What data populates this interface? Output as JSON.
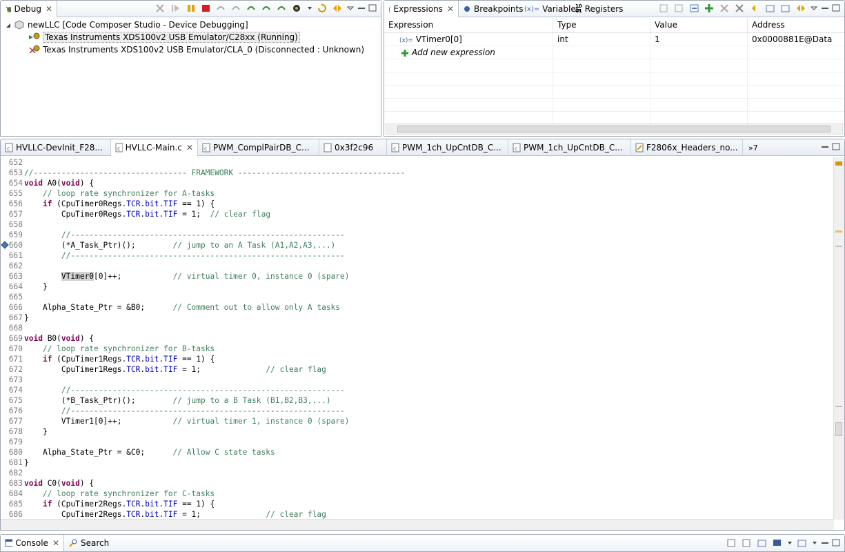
{
  "debug_view": {
    "tab_label": "Debug",
    "tree": [
      {
        "label": "newLLC [Code Composer Studio - Device Debugging]",
        "level": 0
      },
      {
        "label": "Texas Instruments XDS100v2 USB Emulator/C28xx (Running)",
        "level": 1,
        "selected": true
      },
      {
        "label": "Texas Instruments XDS100v2 USB Emulator/CLA_0 (Disconnected : Unknown)",
        "level": 1
      }
    ]
  },
  "expressions_view": {
    "tabs": [
      {
        "label": "Expressions",
        "icon": "expressions-icon",
        "active": true
      },
      {
        "label": "Breakpoints",
        "icon": "breakpoints-icon"
      },
      {
        "label": "Variables",
        "icon": "variables-icon"
      },
      {
        "label": "Registers",
        "icon": "registers-icon"
      }
    ],
    "columns": [
      "Expression",
      "Type",
      "Value",
      "Address"
    ],
    "rows": [
      {
        "expression": "VTimer0[0]",
        "type": "int",
        "value": "1",
        "address": "0x0000881E@Data"
      }
    ],
    "add_new_label": "Add new expression"
  },
  "editor": {
    "tabs": [
      {
        "label": "HVLLC-DevInit_F28...",
        "active": false
      },
      {
        "label": "HVLLC-Main.c",
        "active": true
      },
      {
        "label": "PWM_ComplPairDB_C...",
        "active": false
      },
      {
        "label": "0x3f2c96",
        "active": false
      },
      {
        "label": "PWM_1ch_UpCntDB_C...",
        "active": false
      },
      {
        "label": "PWM_1ch_UpCntDB_C...",
        "active": false
      },
      {
        "label": "F2806x_Headers_no...",
        "active": false
      }
    ],
    "overflow_label": "»7",
    "lines": [
      {
        "n": "652",
        "html": ""
      },
      {
        "n": "653",
        "html": "<span class=\"cm\">//--------------------------------- FRAMEWORK ------------------------------------</span>"
      },
      {
        "n": "654",
        "html": "<span class=\"kw\">void</span> A0(<span class=\"kw\">void</span>) {"
      },
      {
        "n": "655",
        "html": "    <span class=\"cm\">// loop rate synchronizer for A-tasks</span>"
      },
      {
        "n": "656",
        "html": "    <span class=\"kw\">if</span> (CpuTimer0Regs.<span class=\"fld\">TCR</span>.<span class=\"fld\">bit</span>.<span class=\"fld\">TIF</span> == 1) {"
      },
      {
        "n": "657",
        "html": "        CpuTimer0Regs.<span class=\"fld\">TCR</span>.<span class=\"fld\">bit</span>.<span class=\"fld\">TIF</span> = 1;  <span class=\"cm\">// clear flag</span>"
      },
      {
        "n": "658",
        "html": ""
      },
      {
        "n": "659",
        "html": "        <span class=\"cm\">//-----------------------------------------------------------</span>"
      },
      {
        "n": "660",
        "html": "        (*A_Task_Ptr)();        <span class=\"cm\">// jump to an A Task (A1,A2,A3,...)</span>"
      },
      {
        "n": "661",
        "html": "        <span class=\"cm\">//-----------------------------------------------------------</span>"
      },
      {
        "n": "662",
        "html": ""
      },
      {
        "n": "663",
        "html": "        <span class=\"hl\">VTimer0</span>[0]++;           <span class=\"cm\">// virtual timer 0, instance 0 (spare)</span>"
      },
      {
        "n": "664",
        "html": "    }"
      },
      {
        "n": "665",
        "html": ""
      },
      {
        "n": "666",
        "html": "    Alpha_State_Ptr = &amp;B0;      <span class=\"cm\">// Comment out to allow only A tasks</span>"
      },
      {
        "n": "667",
        "html": "}"
      },
      {
        "n": "668",
        "html": ""
      },
      {
        "n": "669",
        "html": "<span class=\"kw\">void</span> B0(<span class=\"kw\">void</span>) {"
      },
      {
        "n": "670",
        "html": "    <span class=\"cm\">// loop rate synchronizer for B-tasks</span>"
      },
      {
        "n": "671",
        "html": "    <span class=\"kw\">if</span> (CpuTimer1Regs.<span class=\"fld\">TCR</span>.<span class=\"fld\">bit</span>.<span class=\"fld\">TIF</span> == 1) {"
      },
      {
        "n": "672",
        "html": "        CpuTimer1Regs.<span class=\"fld\">TCR</span>.<span class=\"fld\">bit</span>.<span class=\"fld\">TIF</span> = 1;              <span class=\"cm\">// clear flag</span>"
      },
      {
        "n": "673",
        "html": ""
      },
      {
        "n": "674",
        "html": "        <span class=\"cm\">//-----------------------------------------------------------</span>"
      },
      {
        "n": "675",
        "html": "        (*B_Task_Ptr)();        <span class=\"cm\">// jump to a B Task (B1,B2,B3,...)</span>"
      },
      {
        "n": "676",
        "html": "        <span class=\"cm\">//-----------------------------------------------------------</span>"
      },
      {
        "n": "677",
        "html": "        VTimer1[0]++;           <span class=\"cm\">// virtual timer 1, instance 0 (spare)</span>"
      },
      {
        "n": "678",
        "html": "    }"
      },
      {
        "n": "679",
        "html": ""
      },
      {
        "n": "680",
        "html": "    Alpha_State_Ptr = &amp;C0;      <span class=\"cm\">// Allow C state tasks</span>"
      },
      {
        "n": "681",
        "html": "}"
      },
      {
        "n": "682",
        "html": ""
      },
      {
        "n": "683",
        "html": "<span class=\"kw\">void</span> C0(<span class=\"kw\">void</span>) {"
      },
      {
        "n": "684",
        "html": "    <span class=\"cm\">// loop rate synchronizer for C-tasks</span>"
      },
      {
        "n": "685",
        "html": "    <span class=\"kw\">if</span> (CpuTimer2Regs.<span class=\"fld\">TCR</span>.<span class=\"fld\">bit</span>.<span class=\"fld\">TIF</span> == 1) {"
      },
      {
        "n": "686",
        "html": "        CpuTimer2Regs.<span class=\"fld\">TCR</span>.<span class=\"fld\">bit</span>.<span class=\"fld\">TIF</span> = 1;              <span class=\"cm\">// clear flag</span>"
      }
    ]
  },
  "console_bar": {
    "tabs": [
      {
        "label": "Console",
        "icon": "console-icon",
        "active": true
      },
      {
        "label": "Search",
        "icon": "search-icon",
        "active": false
      }
    ]
  },
  "colors": {
    "keyword": "#7f0055",
    "comment": "#3f7f5f",
    "field": "#0000c0",
    "selection": "#d4d4d4"
  }
}
